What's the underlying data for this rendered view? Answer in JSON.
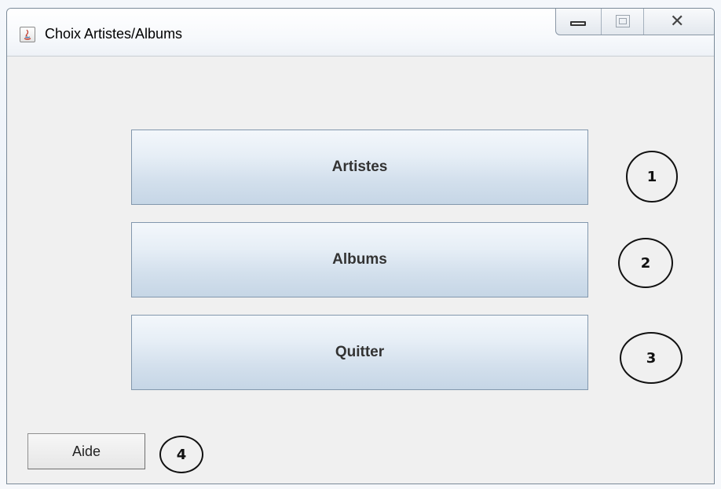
{
  "window": {
    "title": "Choix Artistes/Albums",
    "icon": "java-app-icon"
  },
  "caption": {
    "minimize_icon": "minimize-icon",
    "maximize_icon": "maximize-icon",
    "close_icon": "close-icon"
  },
  "buttons": {
    "artistes": "Artistes",
    "albums": "Albums",
    "quitter": "Quitter",
    "aide": "Aide"
  },
  "callouts": [
    "1",
    "2",
    "3",
    "4"
  ],
  "colors": {
    "button_border": "#8297ad",
    "button_gradient_top": "#f3f7fb",
    "button_gradient_bottom": "#c6d6e6",
    "window_background": "#f0f0f0"
  }
}
